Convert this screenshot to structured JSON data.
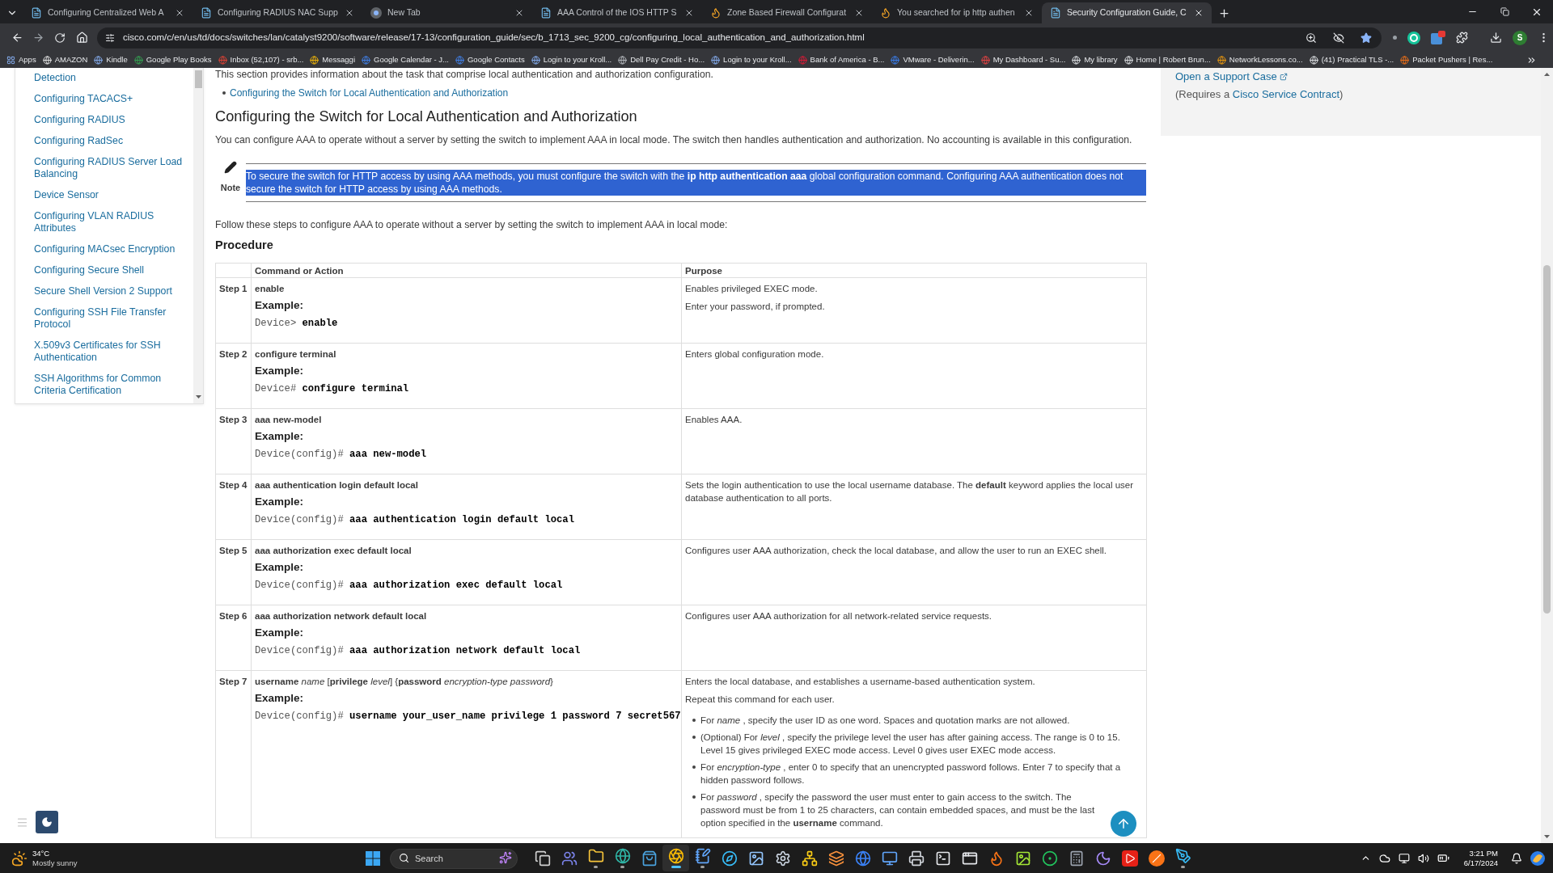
{
  "browser": {
    "tabs": [
      {
        "title": "Configuring Centralized Web A",
        "selected": false
      },
      {
        "title": "Configuring RADIUS NAC Supp",
        "selected": false
      },
      {
        "title": "New Tab",
        "selected": false
      },
      {
        "title": "AAA Control of the IOS HTTP S",
        "selected": false
      },
      {
        "title": "Zone Based Firewall Configurat",
        "selected": false
      },
      {
        "title": "You searched for ip http authen",
        "selected": false
      },
      {
        "title": "Security Configuration Guide, C",
        "selected": true
      }
    ],
    "url": "cisco.com/c/en/us/td/docs/switches/lan/catalyst9200/software/release/17-13/configuration_guide/sec/b_1713_sec_9200_cg/configuring_local_authentication_and_authorization.html",
    "profile_initial": "S",
    "bookmarks": [
      "Apps",
      "AMAZON",
      "Kindle",
      "Google Play Books",
      "Inbox (52,107) - srb...",
      "Messaggi",
      "Google Calendar - J...",
      "Google Contacts",
      "Login to your Kroll...",
      "Dell Pay Credit - Ho...",
      "Login to your Kroll...",
      "Bank of America - B...",
      "VMware - Deliverin...",
      "My Dashboard - Su...",
      "My library",
      "Home | Robert Brun...",
      "NetworkLessons.co...",
      "(41) Practical TLS -...",
      "Packet Pushers | Res..."
    ]
  },
  "sidebar": {
    "items": [
      "Detection",
      "Configuring TACACS+",
      "Configuring RADIUS",
      "Configuring RadSec",
      "Configuring RADIUS Server Load Balancing",
      "Device Sensor",
      "Configuring VLAN RADIUS Attributes",
      "Configuring MACsec Encryption",
      "Configuring Secure Shell",
      "Secure Shell Version 2 Support",
      "Configuring SSH File Transfer Protocol",
      "X.509v3 Certificates for SSH Authentication",
      "SSH Algorithms for Common Criteria Certification"
    ]
  },
  "article": {
    "section_intro": "This section provides information about the task that comprise local authentication and authorization configuration.",
    "toc_links": [
      "Configuring the Switch for Local Authentication and Authorization"
    ],
    "heading": "Configuring the Switch for Local Authentication and Authorization",
    "intro": "You can configure AAA to operate without a server by setting the switch to implement AAA in local mode. The switch then handles authentication and authorization. No accounting is available in this configuration.",
    "note": {
      "label": "Note",
      "text": "To secure the switch for HTTP access by using AAA methods, you must configure the switch with the **ip http authentication aaa** global configuration command. Configuring AAA authentication does not secure the switch for HTTP access by using AAA methods.",
      "selected": true
    },
    "steps_intro": "Follow these steps to configure AAA to operate without a server by setting the switch to implement AAA in local mode:",
    "procedure_title": "Procedure",
    "table": {
      "columns": [
        "Command or Action",
        "Purpose"
      ],
      "rows": [
        {
          "step": "Step 1",
          "kind": "plain",
          "command": "enable",
          "example_label": "Example:",
          "prompt": "Device>",
          "code": "enable",
          "purpose": [
            "Enables privileged EXEC mode.",
            "Enter your password, if prompted."
          ]
        },
        {
          "step": "Step 2",
          "kind": "plain",
          "command": "configure terminal",
          "example_label": "Example:",
          "prompt": "Device#",
          "code": "configure terminal",
          "purpose": [
            "Enters global configuration mode."
          ]
        },
        {
          "step": "Step 3",
          "kind": "plain",
          "command": "aaa new-model",
          "example_label": "Example:",
          "prompt": "Device(config)#",
          "code": "aaa new-model",
          "purpose": [
            "Enables AAA."
          ]
        },
        {
          "step": "Step 4",
          "kind": "plain",
          "command": "aaa authentication login default local",
          "example_label": "Example:",
          "prompt": "Device(config)#",
          "code": "aaa authentication login default local",
          "purpose": [
            "Sets the login authentication to use the local username database. The **default** keyword applies the local user database authentication to all ports."
          ]
        },
        {
          "step": "Step 5",
          "kind": "plain",
          "command": "aaa authorization exec default local",
          "example_label": "Example:",
          "prompt": "Device(config)#",
          "code": "aaa authorization exec default local",
          "purpose": [
            "Configures user AAA authorization, check the local database, and allow the user to run an EXEC shell."
          ]
        },
        {
          "step": "Step 6",
          "kind": "plain",
          "command": "aaa authorization network default local",
          "example_label": "Example:",
          "prompt": "Device(config)#",
          "code": "aaa authorization network default local",
          "purpose": [
            "Configures user AAA authorization for all network-related service requests."
          ]
        },
        {
          "step": "Step 7",
          "kind": "syntax",
          "command": "**username** *name* [**privilege** *level*] {**password** *encryption-type password*}",
          "example_label": "Example:",
          "prompt": "Device(config)#",
          "code": "username your_user_name privilege 1 password 7 secret567",
          "purpose": [
            "Enters the local database, and establishes a username-based authentication system.",
            "Repeat this command for each user."
          ],
          "bullets": [
            "For *name* , specify the user ID as one word. Spaces and quotation marks are not allowed.",
            "(Optional) For *level* , specify the privilege level the user has after gaining access. The range is 0 to 15. Level 15 gives privileged EXEC mode access. Level 0 gives user EXEC mode access.",
            "For *encryption-type* , enter 0 to specify that an unencrypted password follows. Enter 7 to specify that a hidden password follows.",
            "For *password* , specify the password the user must enter to gain access to the switch. The password must be from 1 to 25 characters, can contain embedded spaces, and must be the last option specified in the **username** command."
          ]
        }
      ]
    }
  },
  "support_panel": {
    "link": "Open a Support Case",
    "requirement_before": "(Requires a ",
    "requirement_link": "Cisco Service Contract",
    "requirement_after": ")"
  },
  "taskbar": {
    "weather": {
      "temperature": "34°C",
      "condition": "Mostly sunny"
    },
    "search": {
      "placeholder": "Search"
    },
    "apps": [
      {
        "running": false,
        "selected": false
      },
      {
        "running": false,
        "selected": false
      },
      {
        "running": true,
        "selected": false
      },
      {
        "running": true,
        "selected": false
      },
      {
        "running": false,
        "selected": false
      },
      {
        "running": true,
        "selected": true
      },
      {
        "running": true,
        "selected": false
      },
      {
        "running": false,
        "selected": false
      },
      {
        "running": false,
        "selected": false
      },
      {
        "running": false,
        "selected": false
      },
      {
        "running": false,
        "selected": false
      },
      {
        "running": false,
        "selected": false
      },
      {
        "running": false,
        "selected": false
      },
      {
        "running": false,
        "selected": false
      },
      {
        "running": false,
        "selected": false
      },
      {
        "running": false,
        "selected": false
      },
      {
        "running": false,
        "selected": false
      },
      {
        "running": false,
        "selected": false
      },
      {
        "running": false,
        "selected": false
      },
      {
        "running": false,
        "selected": false
      },
      {
        "running": false,
        "selected": false
      },
      {
        "running": false,
        "selected": false
      },
      {
        "running": false,
        "selected": false
      },
      {
        "running": false,
        "selected": false
      },
      {
        "running": true,
        "selected": false
      }
    ],
    "time": "3:21 PM",
    "date": "6/17/2024"
  }
}
